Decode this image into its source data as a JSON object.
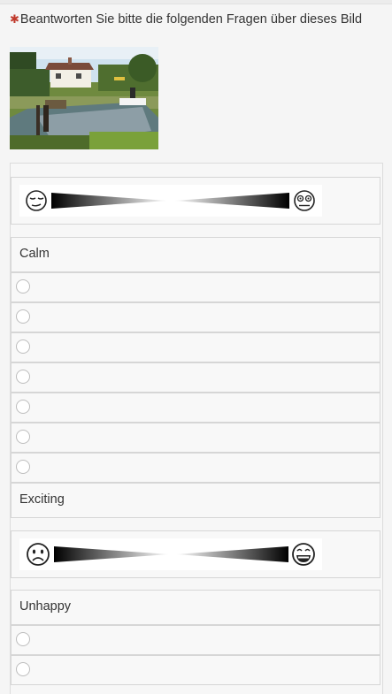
{
  "question": {
    "required_marker": "✱",
    "text": "Beantworten Sie bitte die folgenden Fragen über dieses Bild"
  },
  "photo": {
    "icon": "landscape-photo-icon",
    "description_visible": false
  },
  "scales": [
    {
      "left_face": "relieved-face-icon",
      "right_face": "wide-eyed-face-icon"
    },
    {
      "left_face": "frowning-face-icon",
      "right_face": "grinning-face-icon"
    }
  ],
  "items": [
    {
      "label": "Calm",
      "options_count": 7
    },
    {
      "label": "Exciting"
    },
    {
      "label": "Unhappy"
    }
  ],
  "colors": {
    "required": "#c0392b",
    "border": "#d6d6d6",
    "row_bg": "#f8f8f8"
  }
}
